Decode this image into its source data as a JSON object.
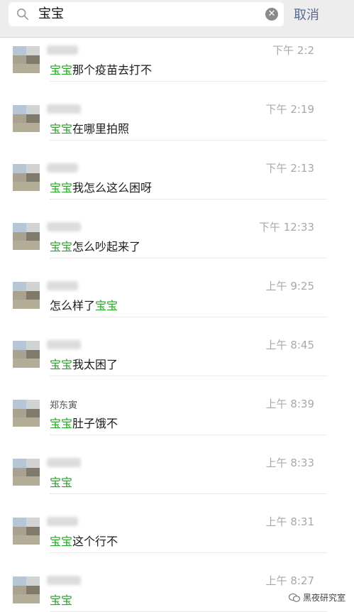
{
  "search": {
    "query": "宝宝",
    "cancel_label": "取消"
  },
  "highlight_color": "#27a327",
  "results": [
    {
      "name": "",
      "time": "下午 2:2",
      "pre": "",
      "hl": "宝宝",
      "post": "那个疫苗去打不"
    },
    {
      "name": "",
      "time": "下午 2:19",
      "pre": "",
      "hl": "宝宝",
      "post": "在哪里拍照"
    },
    {
      "name": "",
      "time": "下午 2:13",
      "pre": "",
      "hl": "宝宝",
      "post": "我怎么这么困呀"
    },
    {
      "name": "",
      "time": "下午 12:33",
      "pre": "",
      "hl": "宝宝",
      "post": "怎么吵起来了"
    },
    {
      "name": "",
      "time": "上午 9:25",
      "pre": "怎么样了",
      "hl": "宝宝",
      "post": ""
    },
    {
      "name": "",
      "time": "上午 8:45",
      "pre": "",
      "hl": "宝宝",
      "post": "我太困了"
    },
    {
      "name": "郑东寅",
      "time": "上午 8:39",
      "pre": "",
      "hl": "宝宝",
      "post": "肚子饿不"
    },
    {
      "name": "",
      "time": "上午 8:33",
      "pre": "",
      "hl": "宝宝",
      "post": ""
    },
    {
      "name": "",
      "time": "上午 8:31",
      "pre": "",
      "hl": "宝宝",
      "post": "这个行不"
    },
    {
      "name": "",
      "time": "上午 8:27",
      "pre": "",
      "hl": "宝宝",
      "post": ""
    }
  ],
  "watermark": {
    "icon": "wechat-icon",
    "text": "黑夜研究室"
  }
}
